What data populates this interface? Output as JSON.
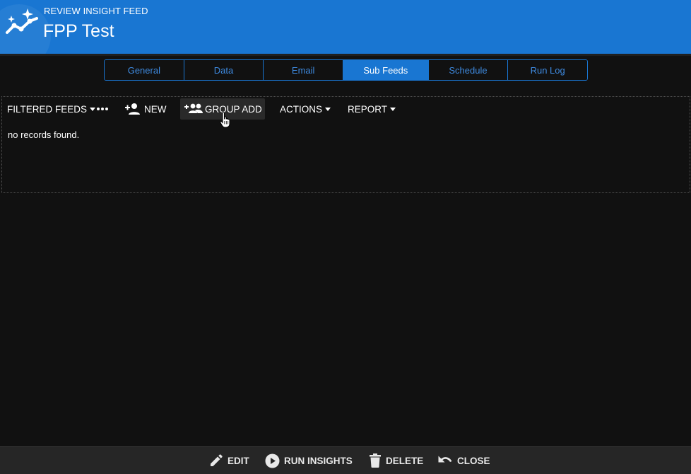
{
  "header": {
    "subtitle": "REVIEW INSIGHT FEED",
    "title": "FPP Test",
    "icon": "insights-icon",
    "color": "#1976d2"
  },
  "tabs": [
    {
      "label": "General",
      "active": false
    },
    {
      "label": "Data",
      "active": false
    },
    {
      "label": "Email",
      "active": false
    },
    {
      "label": "Sub Feeds",
      "active": true
    },
    {
      "label": "Schedule",
      "active": false
    },
    {
      "label": "Run Log",
      "active": false
    }
  ],
  "toolbar": {
    "filtered_feeds": "FILTERED FEEDS",
    "more_icon": "more-horiz-icon",
    "new_label": "NEW",
    "group_add_label": "GROUP ADD",
    "actions_label": "ACTIONS",
    "report_label": "REPORT"
  },
  "list": {
    "empty_message": "no records found."
  },
  "footer": {
    "edit_label": "EDIT",
    "run_label": "RUN INSIGHTS",
    "delete_label": "DELETE",
    "close_label": "CLOSE"
  }
}
